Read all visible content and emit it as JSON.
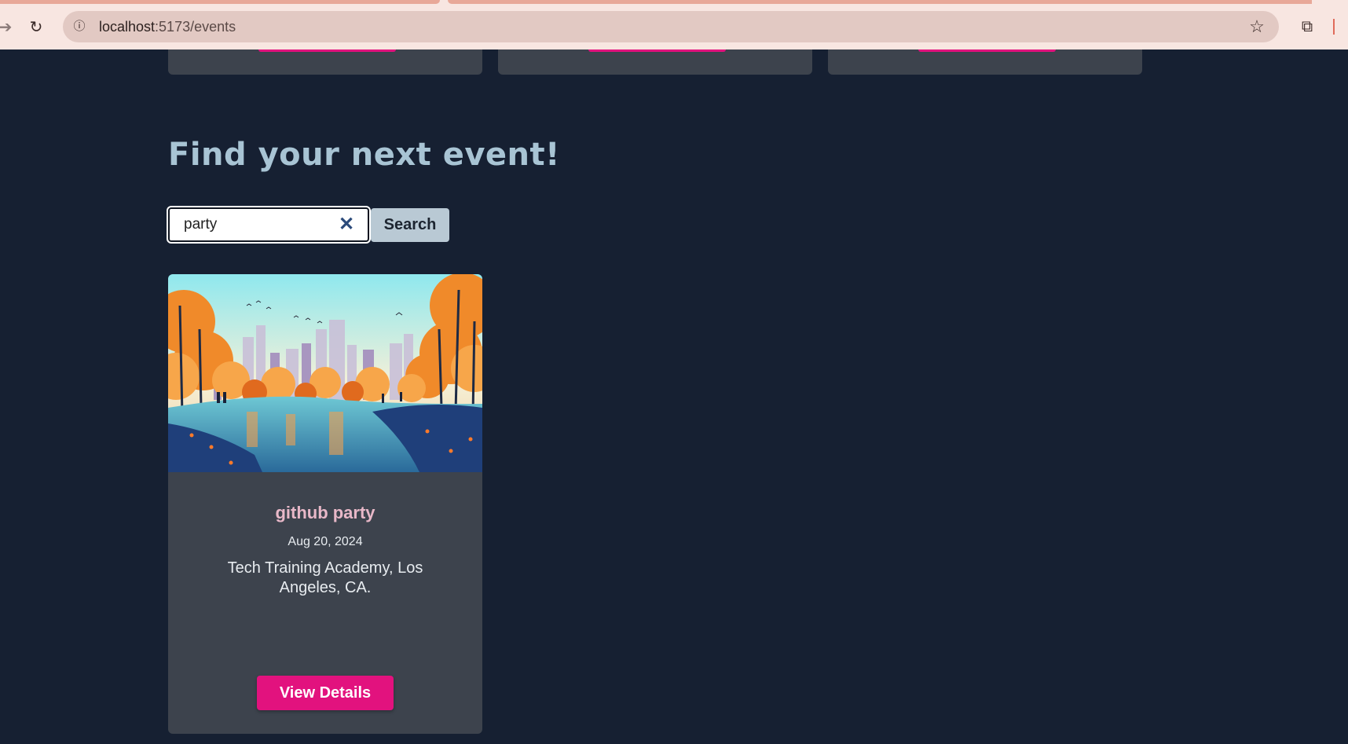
{
  "browser": {
    "url_host": "localhost",
    "url_path": ":5173/events",
    "icons": {
      "forward": "arrow-right-icon",
      "reload": "reload-icon",
      "site_info": "info-icon",
      "bookmark": "star-icon",
      "extensions": "puzzle-icon"
    }
  },
  "page": {
    "heading": "Find your next event!",
    "search": {
      "value": "party",
      "button_label": "Search",
      "clear_icon": "close-icon"
    },
    "events": [
      {
        "title": "github party",
        "date": "Aug 20, 2024",
        "location": "Tech Training Academy, Los Angeles, CA.",
        "button_label": "View Details"
      }
    ]
  },
  "colors": {
    "background": "#162032",
    "card": "#3d434d",
    "accent": "#e2127e",
    "heading": "#a8c4d4",
    "event_title": "#e8b8c8"
  }
}
